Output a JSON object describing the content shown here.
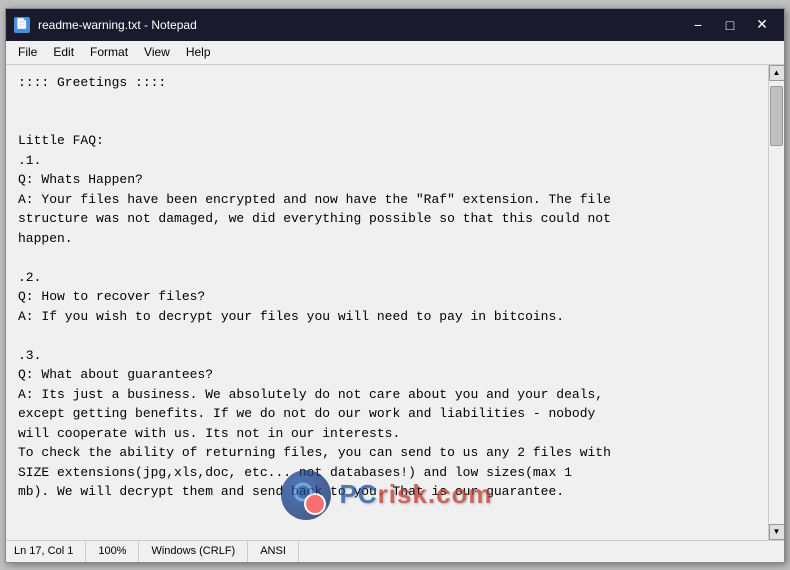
{
  "window": {
    "title": "readme-warning.txt - Notepad",
    "icon": "📄"
  },
  "titlebar": {
    "minimize_label": "−",
    "maximize_label": "□",
    "close_label": "✕"
  },
  "menubar": {
    "items": [
      "File",
      "Edit",
      "Format",
      "View",
      "Help"
    ]
  },
  "content": {
    "text": ":::: Greetings ::::\n\n\nLittle FAQ:\n.1.\nQ: Whats Happen?\nA: Your files have been encrypted and now have the \"Raf\" extension. The file\nstructure was not damaged, we did everything possible so that this could not\nhappen.\n\n.2.\nQ: How to recover files?\nA: If you wish to decrypt your files you will need to pay in bitcoins.\n\n.3.\nQ: What about guarantees?\nA: Its just a business. We absolutely do not care about you and your deals,\nexcept getting benefits. If we do not do our work and liabilities - nobody\nwill cooperate with us. Its not in our interests.\nTo check the ability of returning files, you can send to us any 2 files with\nSIZE extensions(jpg,xls,doc, etc... not databases!) and low sizes(max 1\nmb). We will decrypt them and send back to you. That is our guarantee."
  },
  "statusbar": {
    "position": "Ln 17, Col 1",
    "zoom": "100%",
    "line_ending": "Windows (CRLF)",
    "encoding": "ANSI"
  },
  "watermark": {
    "text_part1": "PC",
    "text_part2": "risk",
    "text_part3": ".com"
  }
}
